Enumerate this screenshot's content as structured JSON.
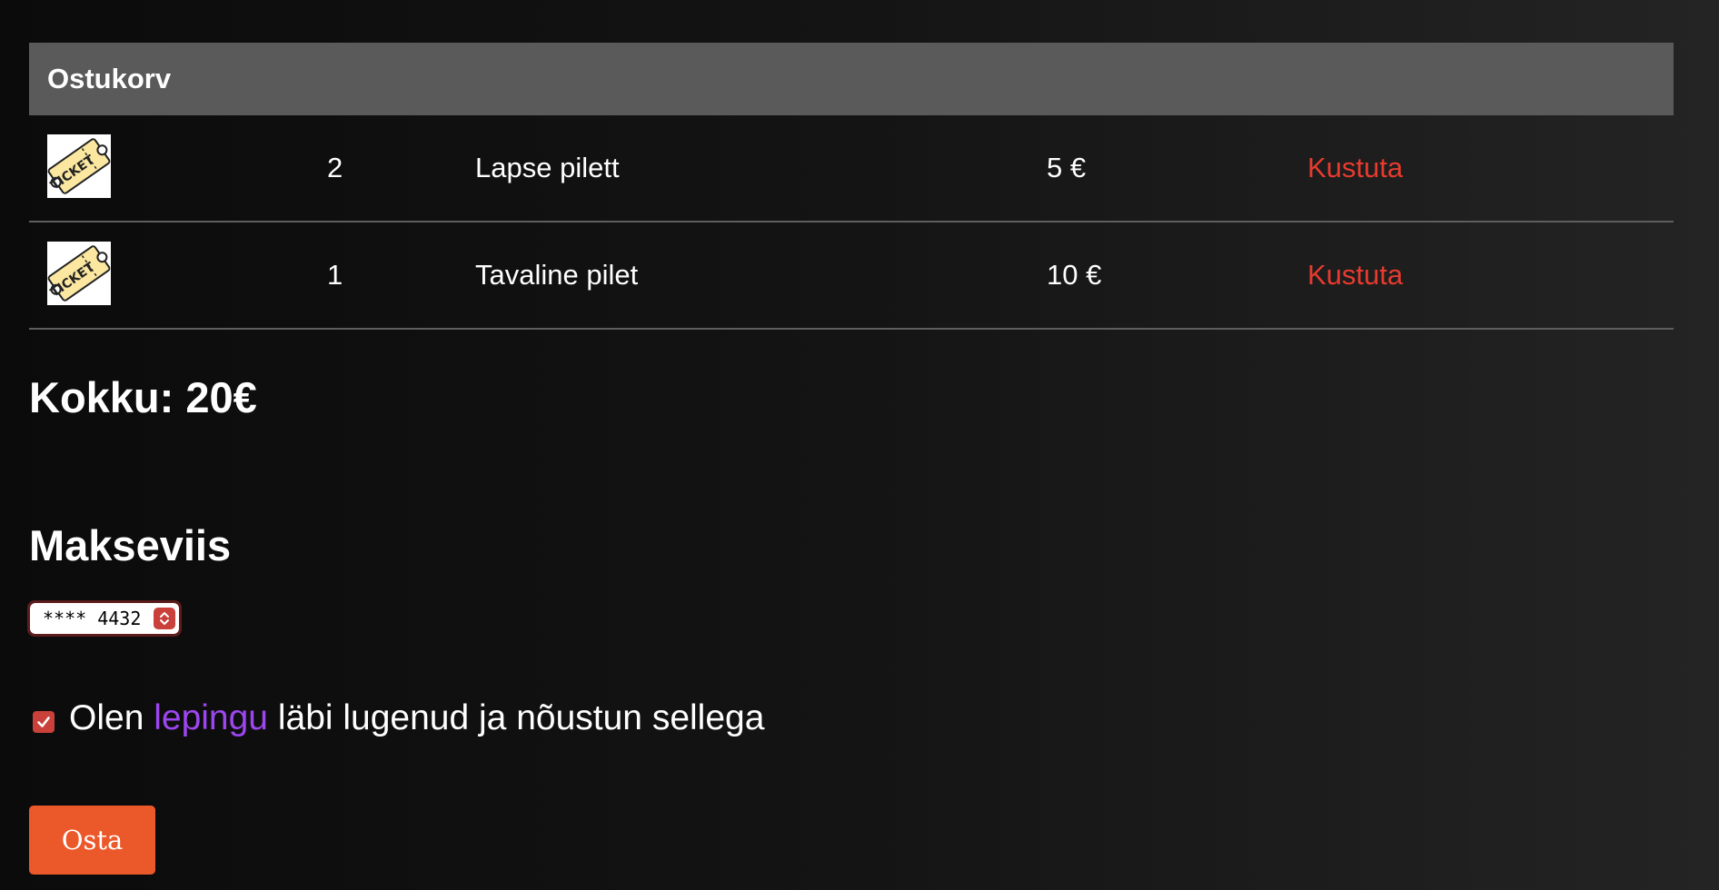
{
  "cart": {
    "title": "Ostukorv",
    "items": [
      {
        "image": "ticket-icon",
        "quantity": "2",
        "name": "Lapse pilett",
        "price": "5 €",
        "delete_label": "Kustuta"
      },
      {
        "image": "ticket-icon",
        "quantity": "1",
        "name": "Tavaline pilet",
        "price": "10 €",
        "delete_label": "Kustuta"
      }
    ],
    "total": "Kokku: 20€"
  },
  "payment": {
    "title": "Makseviis",
    "selected_card": "**** 4432"
  },
  "agreement": {
    "checked": true,
    "prefix": "Olen ",
    "link_text": "lepingu",
    "suffix": " läbi lugenud ja nõustun sellega"
  },
  "buy_button": {
    "label": "Osta"
  },
  "colors": {
    "header_bg": "#5a5a5a",
    "delete": "#e63b2e",
    "link": "#9d46ef",
    "accent": "#c9413a",
    "button": "#eb582a"
  }
}
